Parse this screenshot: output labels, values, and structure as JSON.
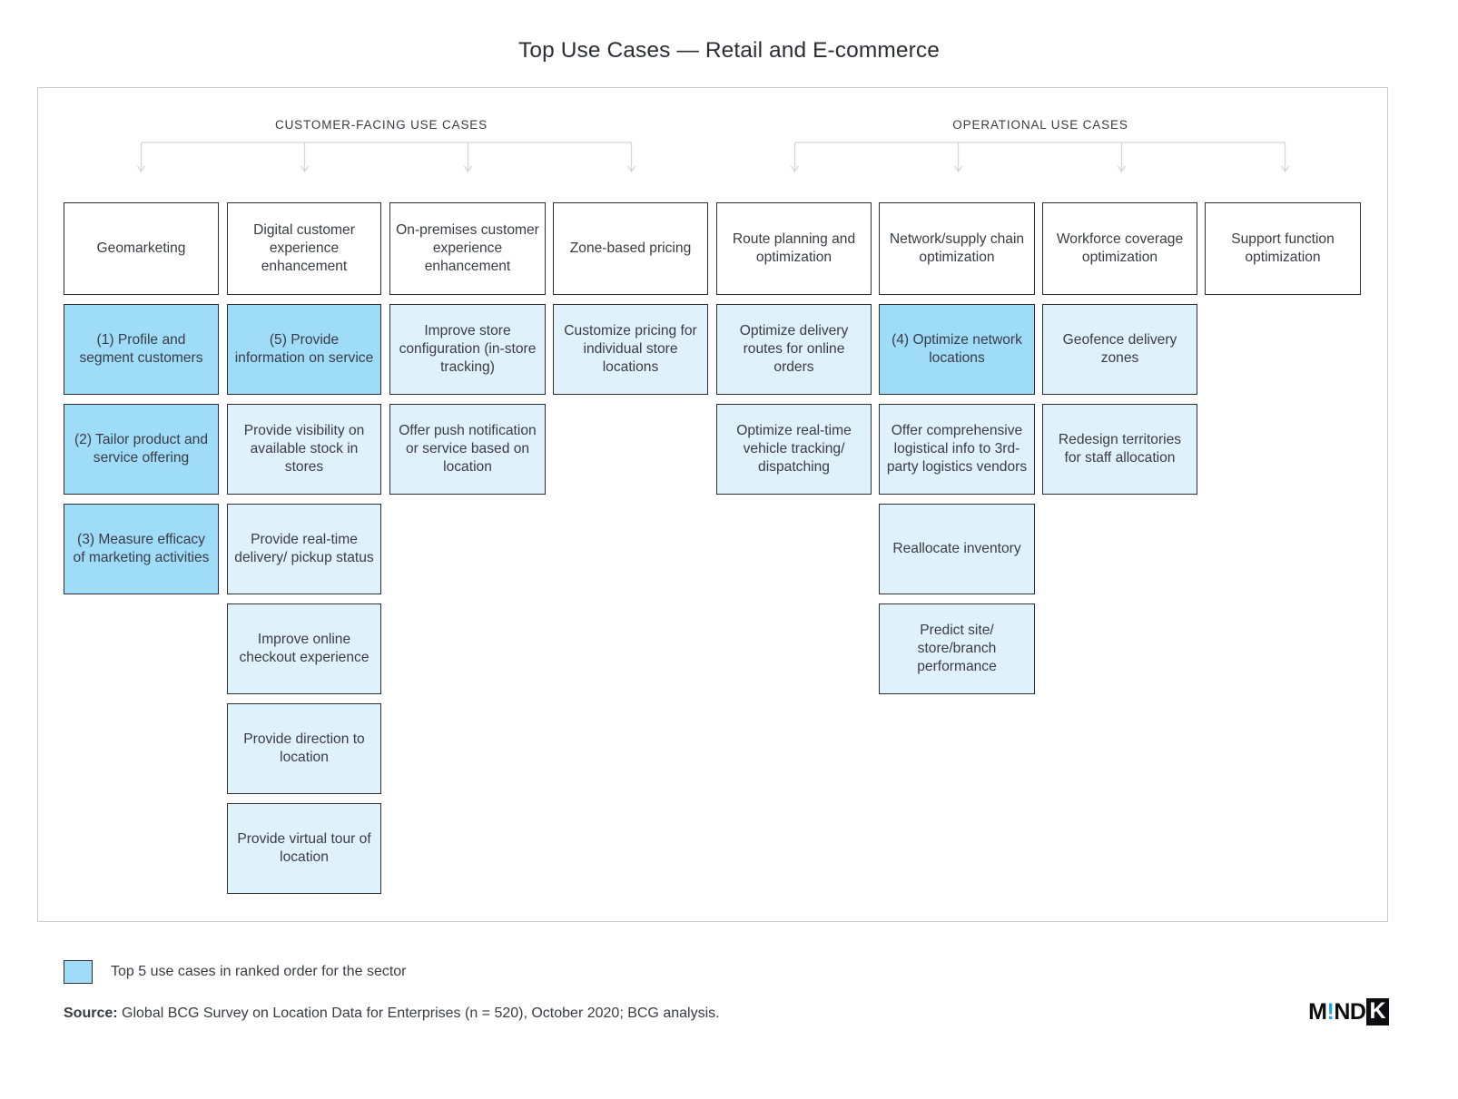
{
  "title": "Top Use Cases — Retail and E-commerce",
  "groups": [
    {
      "label": "CUSTOMER-FACING USE CASES",
      "arrows": 4
    },
    {
      "label": "OPERATIONAL USE CASES",
      "arrows": 4
    }
  ],
  "colors": {
    "top5_fill": "#9fdcf8",
    "item_fill": "#dff1fb",
    "box_border": "#2d2d36",
    "frame_border": "#c9c9cf",
    "text": "#3b3b46",
    "logo_accent": "#1ea7e1"
  },
  "columns": [
    {
      "header": "Geomarketing",
      "items": [
        {
          "text": "(1) Profile and segment customers",
          "top5": true,
          "rank": 1
        },
        {
          "text": "(2) Tailor product and service offering",
          "top5": true,
          "rank": 2
        },
        {
          "text": "(3) Measure efficacy of marketing activities",
          "top5": true,
          "rank": 3
        }
      ]
    },
    {
      "header": "Digital customer experience enhancement",
      "items": [
        {
          "text": "(5) Provide information on service",
          "top5": true,
          "rank": 5
        },
        {
          "text": "Provide visibility on available stock in stores",
          "top5": false
        },
        {
          "text": "Provide real-time delivery/ pickup status",
          "top5": false
        },
        {
          "text": "Improve online checkout experience",
          "top5": false
        },
        {
          "text": "Provide direction to location",
          "top5": false
        },
        {
          "text": "Provide virtual tour of location",
          "top5": false
        }
      ]
    },
    {
      "header": "On-premises customer experience enhancement",
      "items": [
        {
          "text": "Improve store configuration (in-store tracking)",
          "top5": false
        },
        {
          "text": "Offer push notification or service based on location",
          "top5": false
        }
      ]
    },
    {
      "header": "Zone-based pricing",
      "items": [
        {
          "text": "Customize pricing for individual store locations",
          "top5": false
        }
      ]
    },
    {
      "header": "Route planning and optimization",
      "items": [
        {
          "text": "Optimize delivery routes for online orders",
          "top5": false
        },
        {
          "text": "Optimize real-time vehicle tracking/ dispatching",
          "top5": false
        }
      ]
    },
    {
      "header": "Network/supply chain optimization",
      "items": [
        {
          "text": "(4) Optimize network locations",
          "top5": true,
          "rank": 4
        },
        {
          "text": "Offer comprehensive logistical info to 3rd-party logistics vendors",
          "top5": false
        },
        {
          "text": "Reallocate inventory",
          "top5": false
        },
        {
          "text": "Predict site/ store/branch performance",
          "top5": false
        }
      ]
    },
    {
      "header": "Workforce coverage optimization",
      "items": [
        {
          "text": "Geofence delivery zones",
          "top5": false
        },
        {
          "text": "Redesign territories for staff allocation",
          "top5": false
        }
      ]
    },
    {
      "header": "Support function optimization",
      "items": []
    }
  ],
  "legend": {
    "text": "Top 5 use cases in ranked order for the sector"
  },
  "source": {
    "label": "Source:",
    "text": " Global BCG Survey on Location Data for Enterprises (n = 520), October 2020; BCG analysis."
  },
  "logo": {
    "part1": "M",
    "excl": "!",
    "part2": "ND",
    "part3": "K"
  }
}
